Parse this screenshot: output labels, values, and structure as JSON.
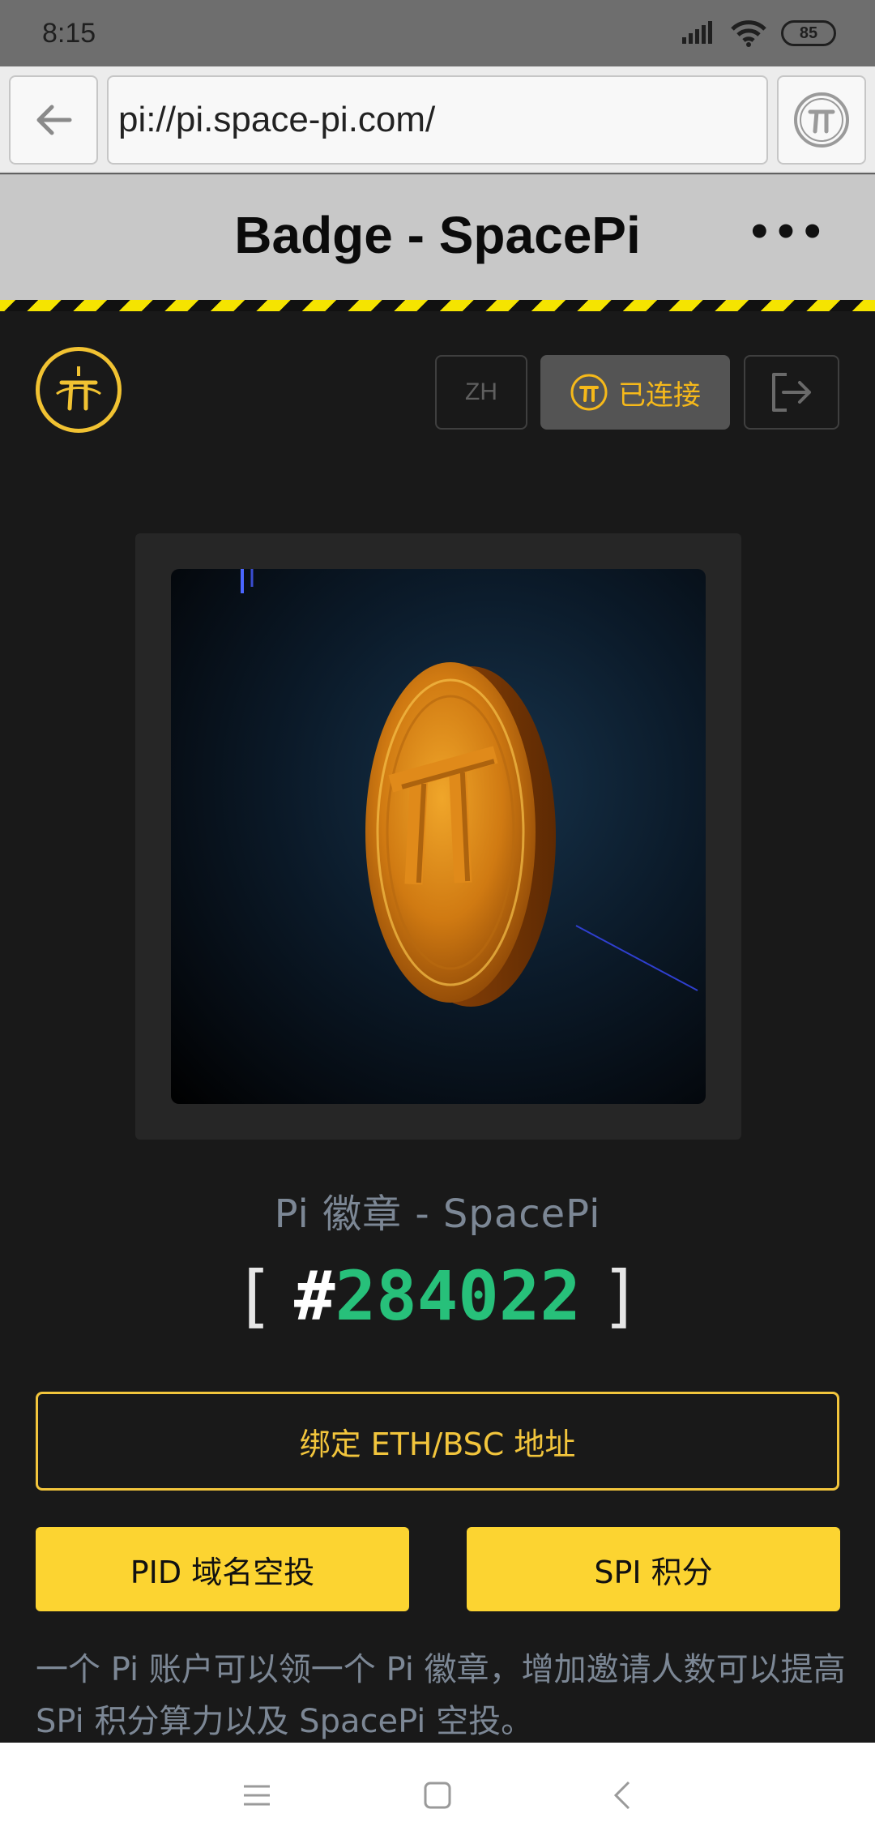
{
  "status_bar": {
    "time": "8:15",
    "battery": "85"
  },
  "browser": {
    "url": "pi://pi.space-pi.com/"
  },
  "title_bar": {
    "title": "Badge - SpacePi",
    "more": "•••"
  },
  "header": {
    "lang_label": "ZH",
    "connect_label": "已连接"
  },
  "badge": {
    "name": "Pi 徽章 - SpacePi",
    "bracket_open": "[",
    "hash": "#",
    "number": "284022",
    "bracket_close": "]"
  },
  "actions": {
    "bind_label": "绑定 ETH/BSC 地址",
    "pid_label": "PID 域名空投",
    "spi_label": "SPI 积分"
  },
  "description": "一个 Pi 账户可以领一个 Pi 徽章，增加邀请人数可以提高 SPi 积分算力以及 SpacePi 空投。",
  "colors": {
    "accent": "#fcd431",
    "number": "#27c07a",
    "muted": "#7c8795",
    "background": "#191919"
  },
  "icons": [
    "back-arrow-icon",
    "pi-coin-icon",
    "spacepi-logo-icon",
    "logout-icon",
    "menu-icon",
    "home-icon",
    "back-icon"
  ]
}
